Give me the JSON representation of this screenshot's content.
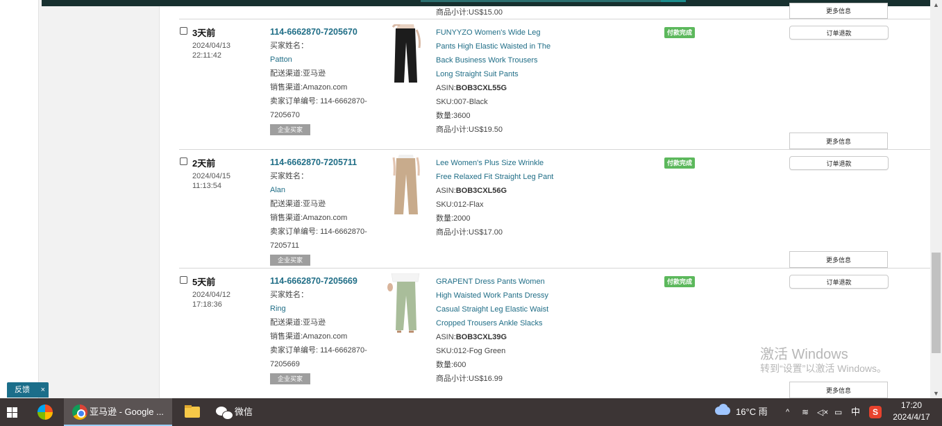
{
  "orders": [
    {
      "age": "3天前",
      "date": "2024/04/13",
      "time": "22:11:42",
      "order_id": "114-6662870-7205670",
      "buyer_label": "买家姓名：",
      "buyer_name": "Patton",
      "shipping": "配送渠道:亚马逊",
      "channel": "销售渠道:Amazon.com",
      "seller_order": "卖家订单编号: 114-6662870-7205670",
      "biz_badge": "企业买家",
      "title": "FUNYYZO Women's Wide Leg Pants High Elastic Waisted in The Back Business Work Trousers Long Straight Suit Pants",
      "asin_label": "ASIN:",
      "asin": "BOB3CXL55G",
      "sku": "SKU:007-Black",
      "qty": "数量:3600",
      "subtotal": "商品小计:US$19.50",
      "status": "付款完成",
      "refund": "订单退款",
      "more": "更多信息",
      "pant_color": "#1c1c1c"
    },
    {
      "age": "2天前",
      "date": "2024/04/15",
      "time": "11:13:54",
      "order_id": "114-6662870-7205711",
      "buyer_label": "买家姓名：",
      "buyer_name": "Alan",
      "shipping": "配送渠道:亚马逊",
      "channel": "销售渠道:Amazon.com",
      "seller_order": "卖家订单编号: 114-6662870-7205711",
      "biz_badge": "企业买家",
      "title": "Lee Women's Plus Size Wrinkle Free Relaxed Fit Straight Leg Pant",
      "asin_label": "ASIN:",
      "asin": "BOB3CXL56G",
      "sku": "SKU:012-Flax",
      "qty": "数量:2000",
      "subtotal": "商品小计:US$17.00",
      "status": "付款完成",
      "refund": "订单退款",
      "more": "更多信息",
      "pant_color": "#c8ab8c"
    },
    {
      "age": "5天前",
      "date": "2024/04/12",
      "time": "17:18:36",
      "order_id": "114-6662870-7205669",
      "buyer_label": "买家姓名：",
      "buyer_name": "Ring",
      "shipping": "配送渠道:亚马逊",
      "channel": "销售渠道:Amazon.com",
      "seller_order": "卖家订单编号: 114-6662870-7205669",
      "biz_badge": "企业买家",
      "title": "GRAPENT Dress Pants Women High Waisted Work Pants Dressy Casual Straight Leg Elastic Waist Cropped Trousers Ankle Slacks",
      "asin_label": "ASIN:",
      "asin": "BOB3CXL39G",
      "sku": "SKU:012-Fog Green",
      "qty": "数量:600",
      "subtotal": "商品小计:US$16.99",
      "status": "付款完成",
      "refund": "订单退款",
      "more": "更多信息",
      "pant_color": "#a9bd9a"
    }
  ],
  "prev_order": {
    "subtotal": "商品小计:US$15.00",
    "more": "更多信息"
  },
  "feedback": {
    "label": "反馈",
    "close": "×"
  },
  "watermark": {
    "line1": "激活 Windows",
    "line2": "转到“设置”以激活 Windows。"
  },
  "taskbar": {
    "chrome_label": "亚马逊 - Google ...",
    "wechat_label": "微信",
    "weather": "16°C 雨",
    "ime": "中",
    "time": "17:20",
    "date": "2024/4/17"
  },
  "colors": {
    "link": "#1f6d86",
    "paid": "#5cb85c",
    "topbar": "#17302f",
    "taskbar": "#3c3535"
  }
}
